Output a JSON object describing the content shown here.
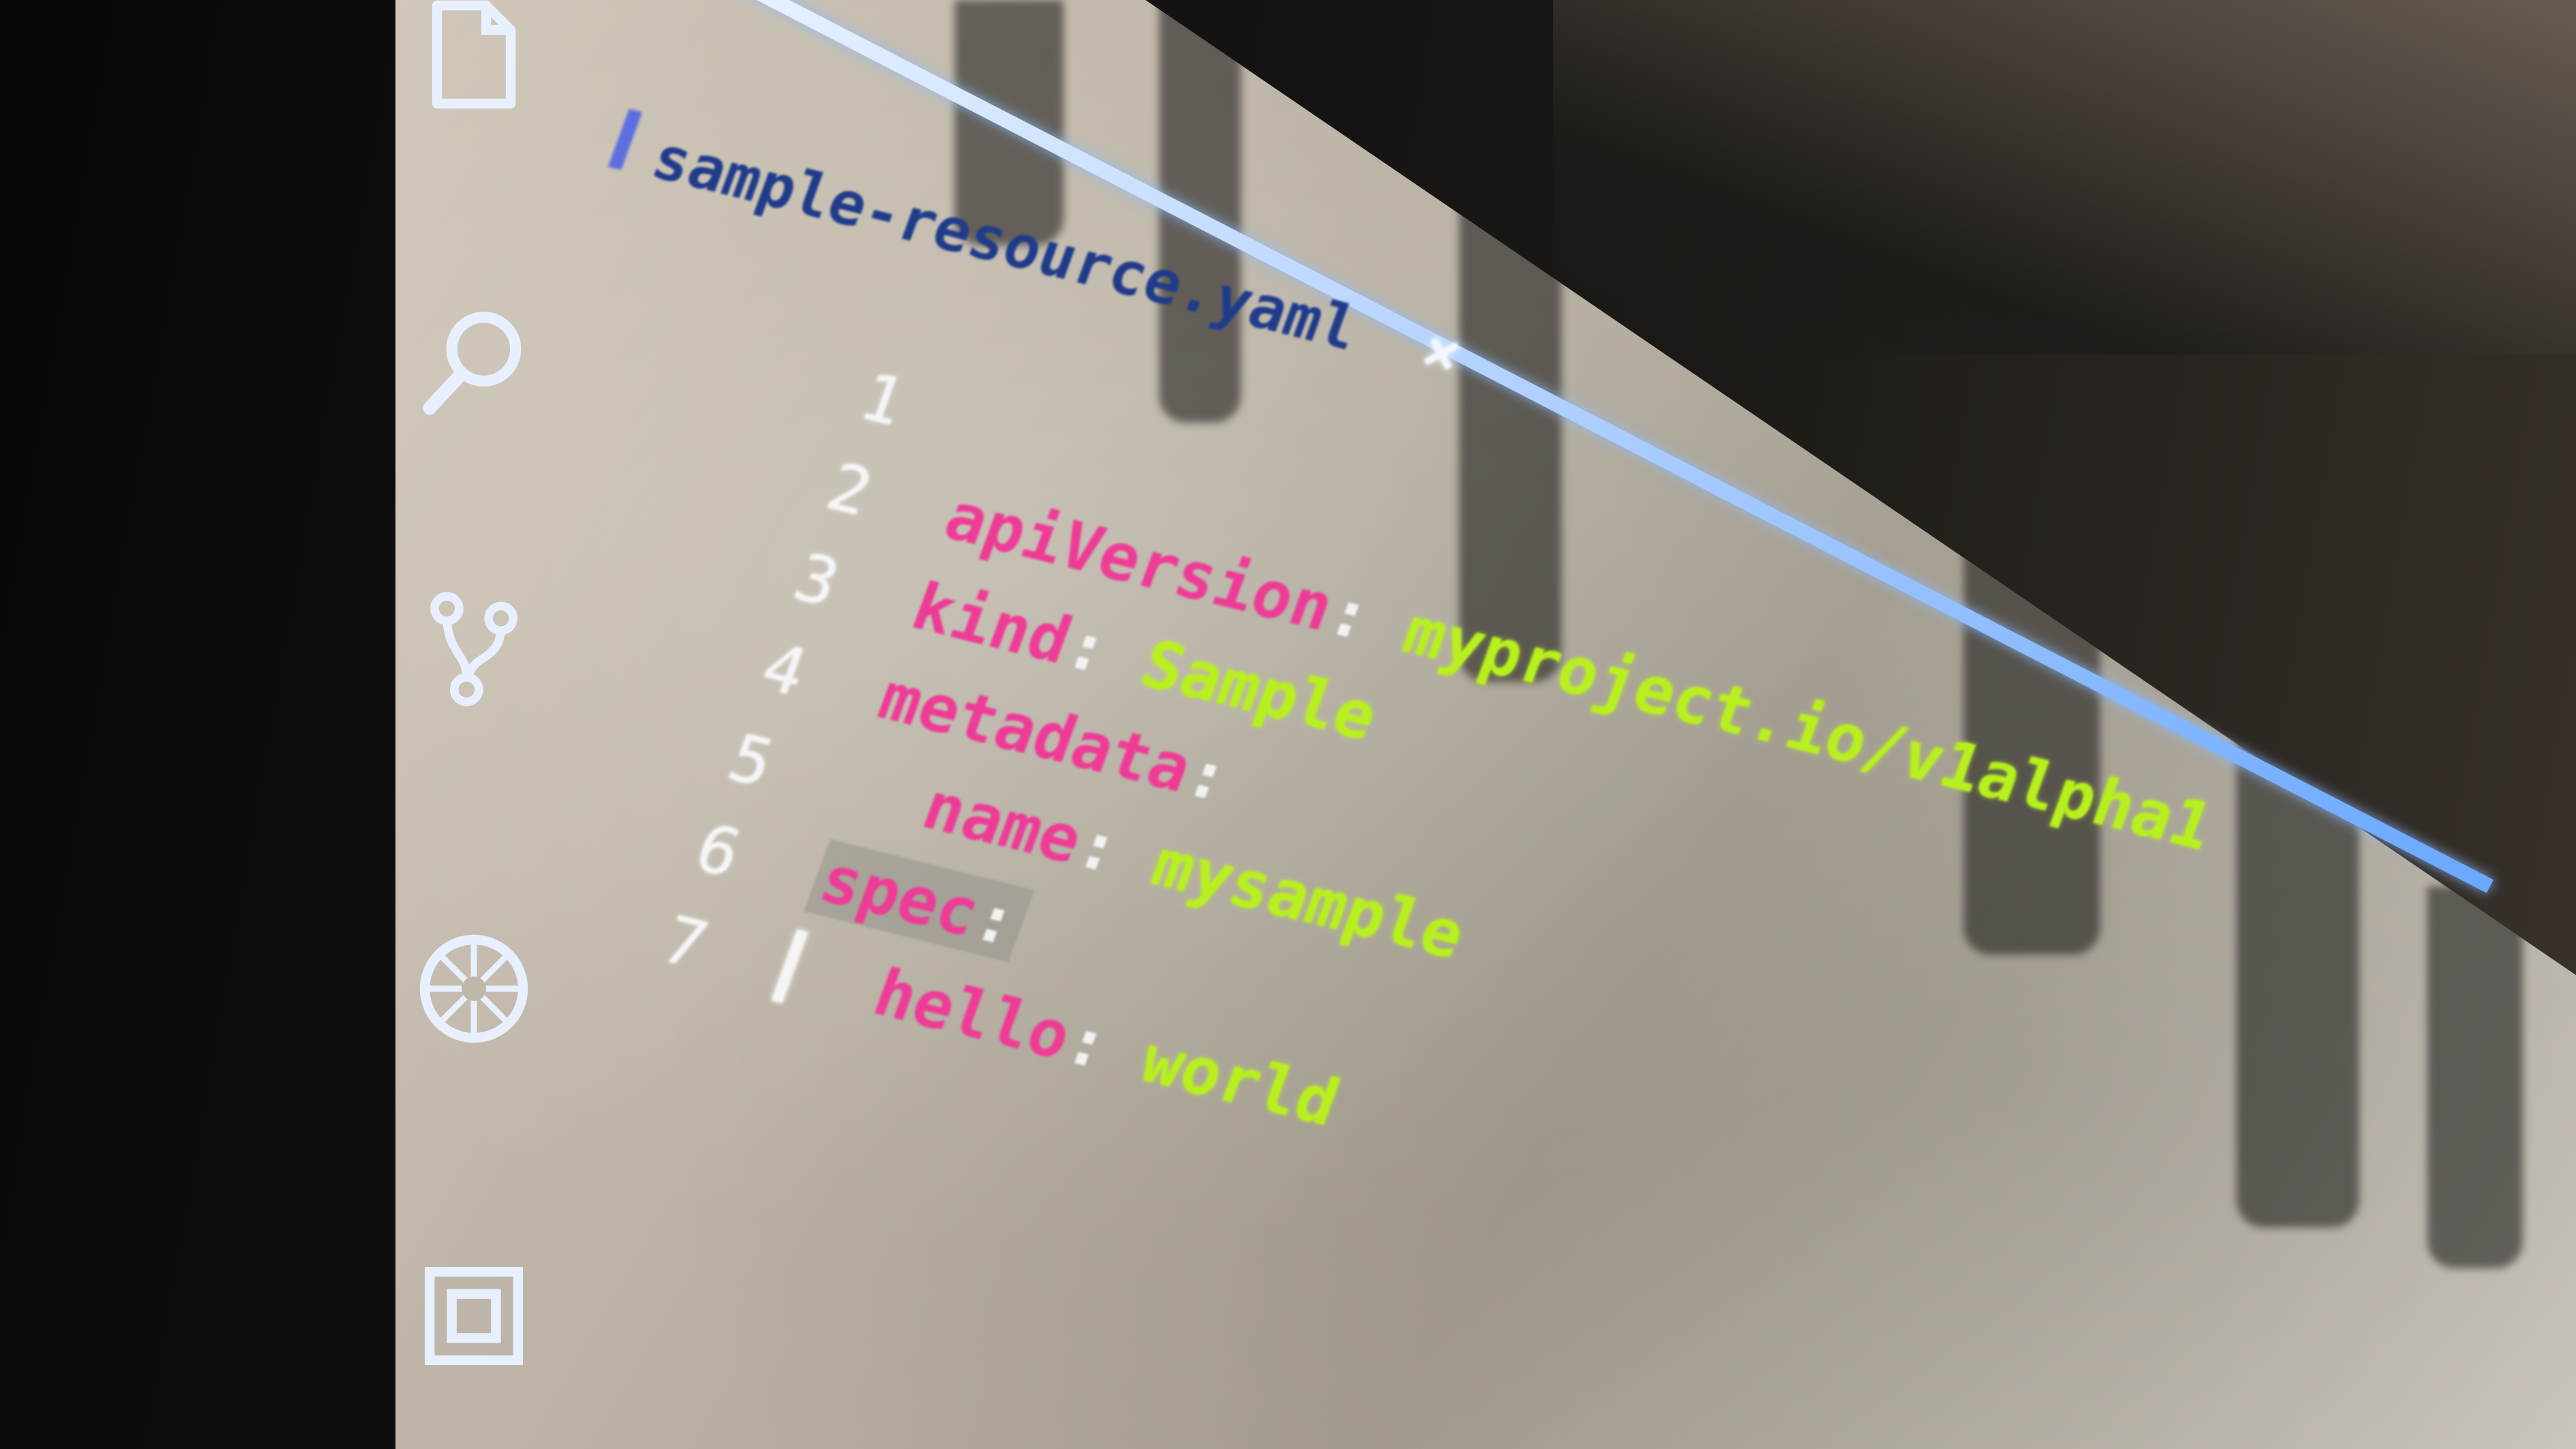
{
  "editor": {
    "tab": {
      "filename": "sample-resource.yaml",
      "close_label": "×"
    },
    "lines": [
      {
        "number": "1",
        "key": "",
        "sep": "",
        "value": ""
      },
      {
        "number": "2",
        "key": "apiVersion",
        "sep": ":",
        "value": "myproject.io/v1alpha1"
      },
      {
        "number": "3",
        "key": "kind",
        "sep": ":",
        "value": "Sample"
      },
      {
        "number": "4",
        "key": "metadata",
        "sep": ":",
        "value": ""
      },
      {
        "number": "5",
        "key": "name",
        "sep": ":",
        "value": "mysample",
        "indent": "  "
      },
      {
        "number": "6",
        "key": "spec",
        "sep": ":",
        "value": ""
      },
      {
        "number": "7",
        "key": "hello",
        "sep": ":",
        "value": "world",
        "indent": "  "
      }
    ]
  },
  "activity_bar": {
    "icons": [
      "explorer-icon",
      "search-icon",
      "source-control-icon",
      "debug-icon",
      "extensions-icon"
    ]
  },
  "colors": {
    "key": "#ee3b96",
    "value": "#b8f01e",
    "tab_text": "#1f3b8a",
    "line_number": "#f5f5f7",
    "icon": "#e8f0ff"
  }
}
